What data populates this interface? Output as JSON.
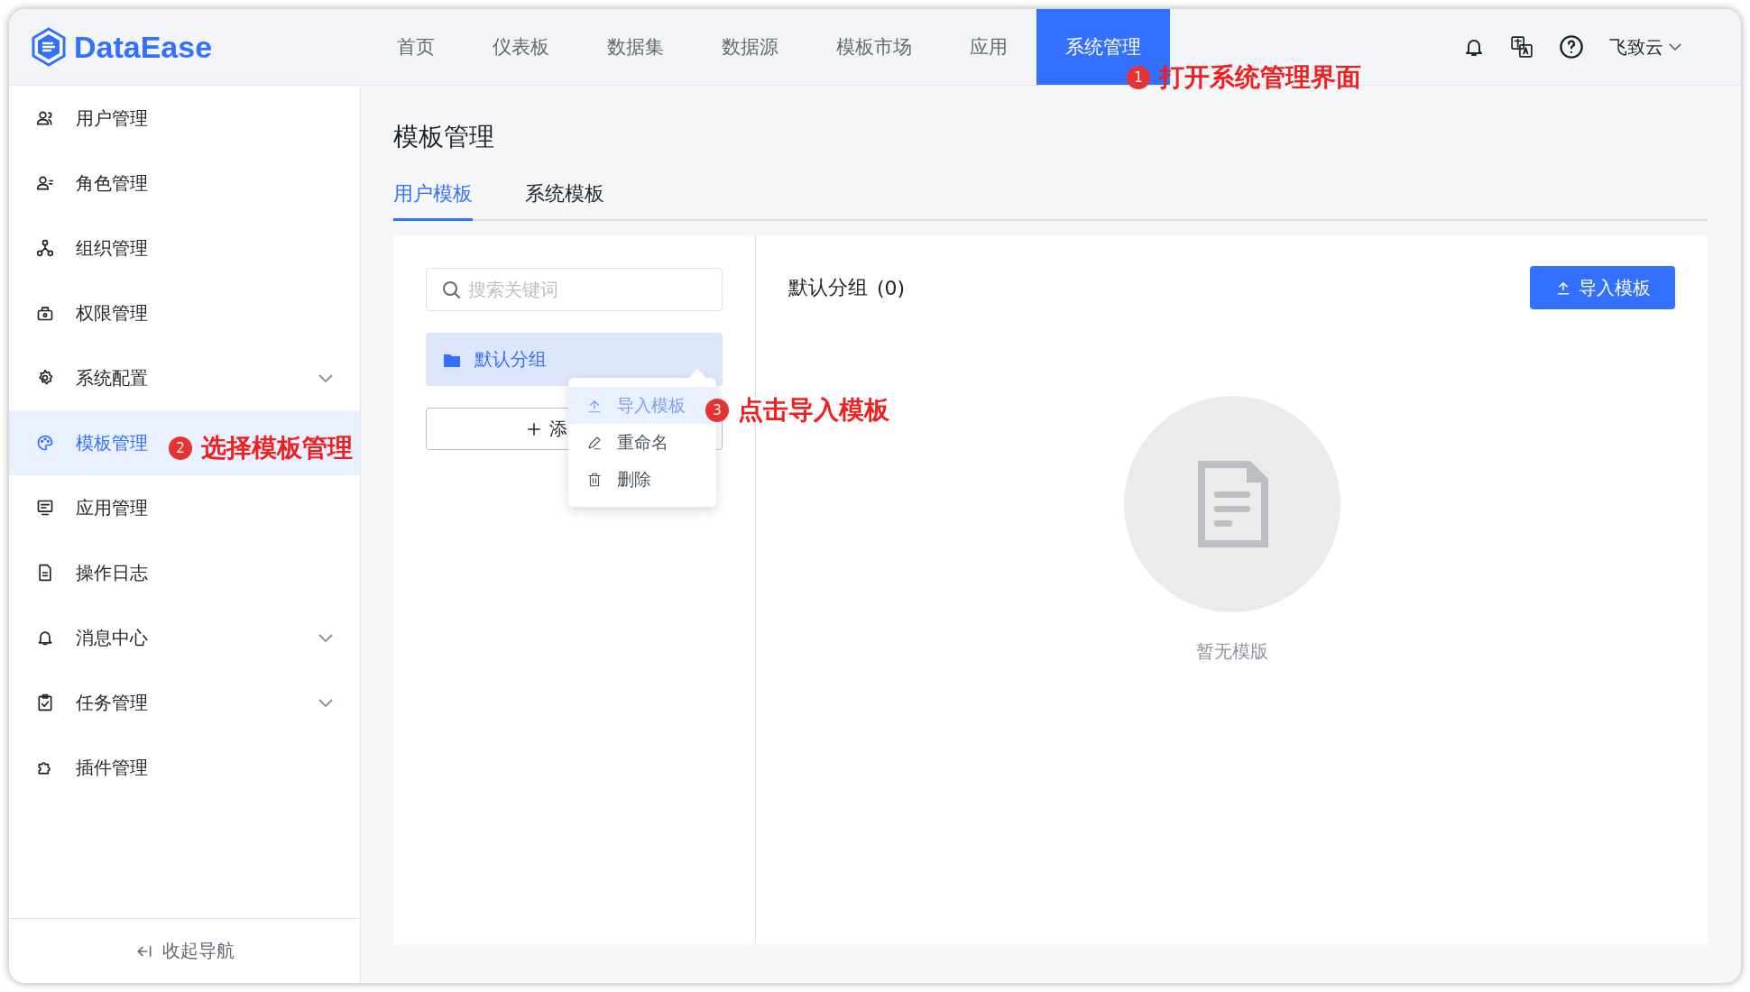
{
  "app": {
    "logo": "DataEase",
    "user": "飞致云"
  },
  "nav": [
    {
      "label": "首页",
      "selected": false
    },
    {
      "label": "仪表板",
      "selected": false
    },
    {
      "label": "数据集",
      "selected": false
    },
    {
      "label": "数据源",
      "selected": false
    },
    {
      "label": "模板市场",
      "selected": false
    },
    {
      "label": "应用",
      "selected": false
    },
    {
      "label": "系统管理",
      "selected": true
    }
  ],
  "sidebar": {
    "items": [
      {
        "label": "用户管理",
        "selected": false,
        "expandable": false
      },
      {
        "label": "角色管理",
        "selected": false,
        "expandable": false
      },
      {
        "label": "组织管理",
        "selected": false,
        "expandable": false
      },
      {
        "label": "权限管理",
        "selected": false,
        "expandable": false
      },
      {
        "label": "系统配置",
        "selected": false,
        "expandable": true
      },
      {
        "label": "模板管理",
        "selected": true,
        "expandable": false
      },
      {
        "label": "应用管理",
        "selected": false,
        "expandable": false
      },
      {
        "label": "操作日志",
        "selected": false,
        "expandable": false
      },
      {
        "label": "消息中心",
        "selected": false,
        "expandable": true
      },
      {
        "label": "任务管理",
        "selected": false,
        "expandable": true
      },
      {
        "label": "插件管理",
        "selected": false,
        "expandable": false
      }
    ],
    "collapse": "收起导航"
  },
  "page": {
    "title": "模板管理",
    "tabs": [
      {
        "label": "用户模板",
        "selected": true
      },
      {
        "label": "系统模板",
        "selected": false
      }
    ]
  },
  "groups": {
    "search_placeholder": "搜索关键词",
    "items": [
      {
        "label": "默认分组",
        "selected": true
      }
    ],
    "add_button": "添"
  },
  "context_menu": [
    {
      "label": "导入模板",
      "selected": true
    },
    {
      "label": "重命名",
      "selected": false
    },
    {
      "label": "删除",
      "selected": false
    }
  ],
  "content": {
    "heading": "默认分组",
    "count": "(0)",
    "import_button": "导入模板",
    "empty_text": "暂无模版"
  },
  "annotations": [
    {
      "number": "1",
      "text": "打开系统管理界面"
    },
    {
      "number": "2",
      "text": "选择模板管理"
    },
    {
      "number": "3",
      "text": "点击导入模板"
    }
  ]
}
